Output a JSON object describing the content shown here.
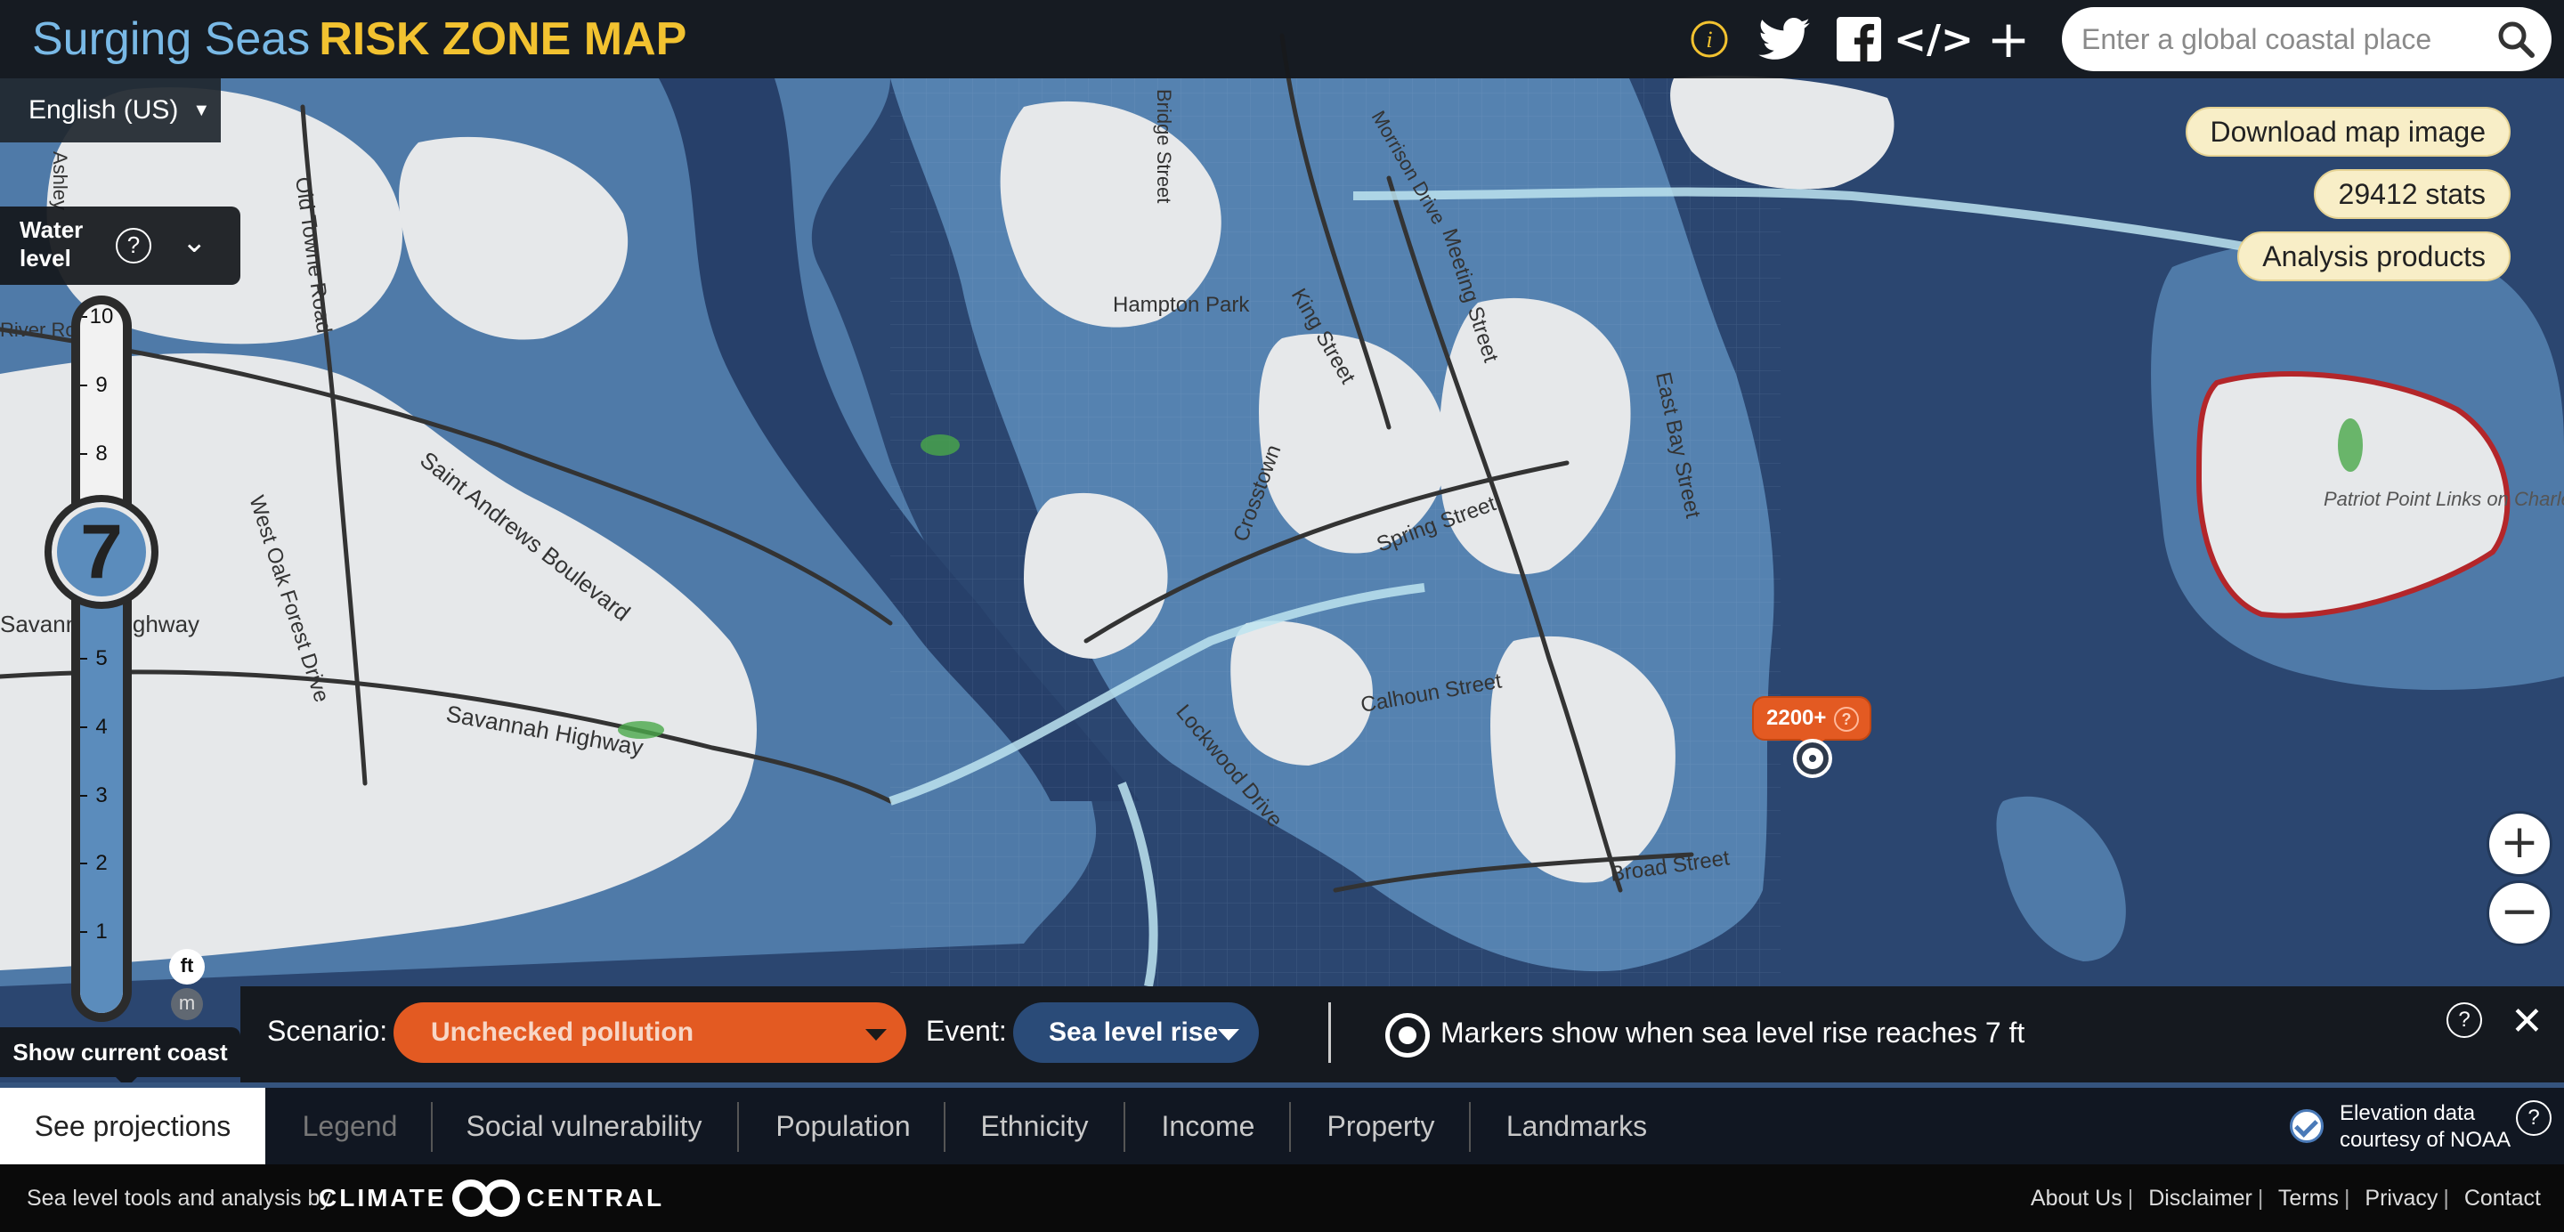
{
  "app": {
    "title_part1": "Surging Seas",
    "title_part2": "RISK ZONE MAP",
    "search_placeholder": "Enter a global coastal place",
    "language": "English (US)",
    "icons": [
      "info-icon",
      "twitter-icon",
      "facebook-icon",
      "embed-code-icon",
      "plus-icon",
      "search-icon"
    ]
  },
  "water_level": {
    "label": "Water level",
    "help": "?",
    "current": "7",
    "max": 10,
    "ticks": [
      "10",
      "9",
      "8",
      "6",
      "5",
      "4",
      "3",
      "2",
      "1"
    ],
    "unit_selected": "ft",
    "unit_other": "m"
  },
  "right_buttons": {
    "download": "Download map image",
    "stats": "29412 stats",
    "analysis": "Analysis products"
  },
  "zoom": {
    "in": "+",
    "out": "−"
  },
  "marker": {
    "label": "2200+",
    "help": "?"
  },
  "map_labels": [
    "Hampton Park",
    "King Street",
    "Meeting Street",
    "East Bay Street",
    "Saint Andrews Boulevard",
    "West Oak Forest Drive",
    "Savannah Highway",
    "Crosstown",
    "Spring Street",
    "Calhoun Street",
    "Lockwood Drive",
    "Broad Street",
    "Patriot Point Links on Charleston Harbor",
    "Old Towne Road",
    "Savannah Highway",
    "River Road",
    "Morrison Drive",
    "Bridge Street",
    "Ashley"
  ],
  "scenario": {
    "scenario_label": "Scenario:",
    "scenario_value": "Unchecked pollution",
    "event_label": "Event:",
    "event_value": "Sea level rise",
    "markers_text": "Markers show when sea level rise reaches 7 ft",
    "help": "?",
    "close": "✕",
    "show_current_coast": "Show current coast"
  },
  "tabs": {
    "active": "See projections",
    "items": [
      "Legend",
      "Social vulnerability",
      "Population",
      "Ethnicity",
      "Income",
      "Property",
      "Landmarks"
    ]
  },
  "noaa": {
    "line1": "Elevation data",
    "line2": "courtesy of NOAA",
    "help": "?"
  },
  "footer": {
    "text": "Sea level tools and analysis by",
    "brand_left": "CLIMATE",
    "brand_right": "CENTRAL",
    "links": [
      "About Us",
      "Disclaimer",
      "Terms",
      "Privacy",
      "Contact"
    ]
  },
  "colors": {
    "land": "#e8e9eb",
    "flood": "#4f7aa8",
    "water": "#2b4670",
    "brand_yellow": "#f2c230",
    "brand_blue": "#79b9e6",
    "scenario_orange": "#e35a22",
    "button_cream": "#f8eec7"
  }
}
